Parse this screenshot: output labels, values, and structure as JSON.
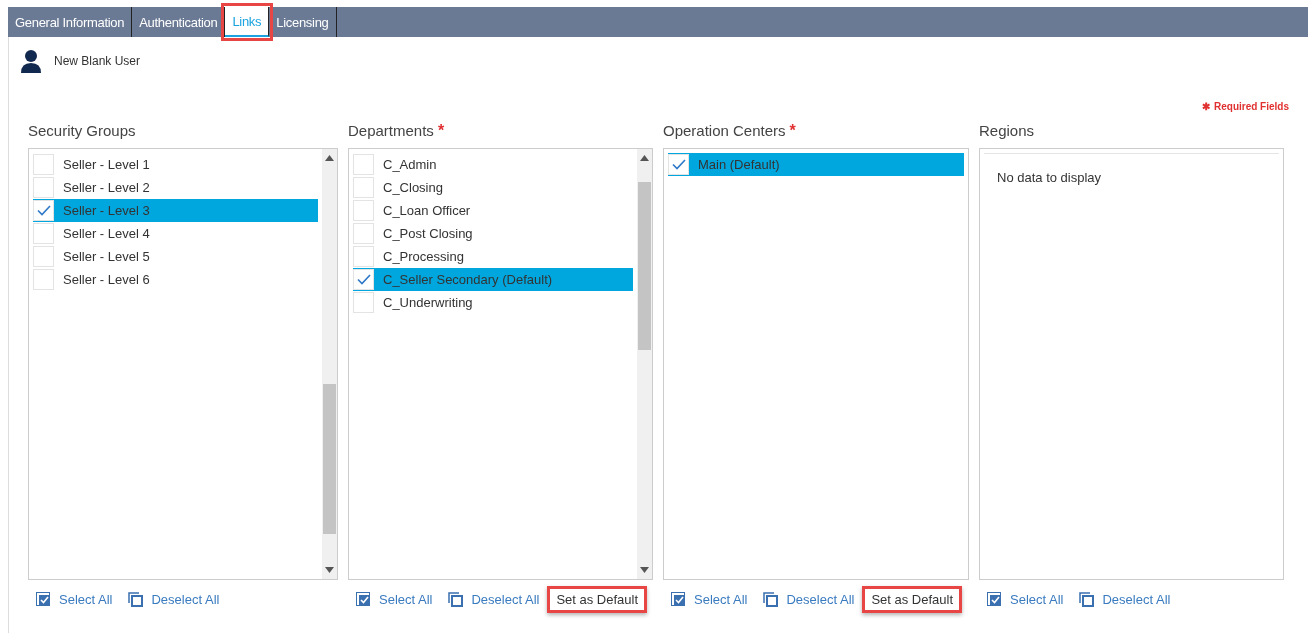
{
  "tabs": [
    {
      "label": "General Information",
      "selected": false,
      "highlighted": false
    },
    {
      "label": "Authentication",
      "selected": false,
      "highlighted": false
    },
    {
      "label": "Links",
      "selected": true,
      "highlighted": true
    },
    {
      "label": "Licensing",
      "selected": false,
      "highlighted": false
    }
  ],
  "user": {
    "name": "New Blank User"
  },
  "required_note": {
    "mark": "✱",
    "label": "Required Fields"
  },
  "panels": [
    {
      "title": "Security Groups",
      "required": false,
      "scrollable": true,
      "scrolled_to_end": true,
      "items": [
        {
          "label": "Seller - Level 1",
          "checked": false,
          "selected": false
        },
        {
          "label": "Seller - Level 2",
          "checked": false,
          "selected": false
        },
        {
          "label": "Seller - Level 3",
          "checked": true,
          "selected": true
        },
        {
          "label": "Seller - Level 4",
          "checked": false,
          "selected": false
        },
        {
          "label": "Seller - Level 5",
          "checked": false,
          "selected": false
        },
        {
          "label": "Seller - Level 6",
          "checked": false,
          "selected": false
        }
      ],
      "actions": [
        {
          "kind": "select",
          "label": "Select All",
          "highlighted": false
        },
        {
          "kind": "deselect",
          "label": "Deselect All",
          "highlighted": false
        }
      ]
    },
    {
      "title": "Departments",
      "required": true,
      "required_mark": "*",
      "scrollable": true,
      "scrolled_to_end": false,
      "items": [
        {
          "label": "C_Admin",
          "checked": false,
          "selected": false
        },
        {
          "label": "C_Closing",
          "checked": false,
          "selected": false
        },
        {
          "label": "C_Loan Officer",
          "checked": false,
          "selected": false
        },
        {
          "label": "C_Post Closing",
          "checked": false,
          "selected": false
        },
        {
          "label": "C_Processing",
          "checked": false,
          "selected": false
        },
        {
          "label": "C_Seller Secondary (Default)",
          "checked": true,
          "selected": true
        },
        {
          "label": "C_Underwriting",
          "checked": false,
          "selected": false
        }
      ],
      "actions": [
        {
          "kind": "select",
          "label": "Select All",
          "highlighted": false
        },
        {
          "kind": "deselect",
          "label": "Deselect All",
          "highlighted": false
        },
        {
          "kind": "default",
          "label": "Set as Default",
          "highlighted": true
        }
      ]
    },
    {
      "title": "Operation Centers",
      "required": true,
      "required_mark": "*",
      "items": [
        {
          "label": "Main (Default)",
          "checked": true,
          "selected": true
        }
      ],
      "actions": [
        {
          "kind": "select",
          "label": "Select All",
          "highlighted": false
        },
        {
          "kind": "deselect",
          "label": "Deselect All",
          "highlighted": false
        },
        {
          "kind": "default",
          "label": "Set as Default",
          "highlighted": true
        }
      ]
    },
    {
      "title": "Regions",
      "required": false,
      "empty_text": "No data to display",
      "actions": [
        {
          "kind": "select",
          "label": "Select All",
          "highlighted": false
        },
        {
          "kind": "deselect",
          "label": "Deselect All",
          "highlighted": false
        }
      ]
    }
  ]
}
